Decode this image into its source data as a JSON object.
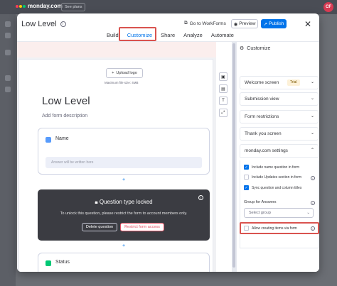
{
  "app": {
    "brand": "monday.com",
    "plans_button": "See plans",
    "avatar_initials": "CF"
  },
  "modal": {
    "title": "Low Level",
    "tabs": [
      {
        "label": "Build",
        "active": false
      },
      {
        "label": "Customize",
        "active": true
      },
      {
        "label": "Share",
        "active": false
      },
      {
        "label": "Analyze",
        "active": false
      },
      {
        "label": "Automate",
        "active": false
      }
    ],
    "goto_workforms": "Go to WorkForms",
    "preview_label": "Preview",
    "publish_label": "Publish",
    "accent_color": "#0073ea"
  },
  "form": {
    "upload_logo": "Upload logo",
    "max_file_size": "Maximum file size: 4MB",
    "title": "Low Level",
    "description_placeholder": "Add form description",
    "q1_name": "Name",
    "q1_answer_placeholder": "Answer will be written here",
    "locked_title": "Question type locked",
    "locked_message": "To unlock this question, please restrict the form to account members only.",
    "delete_question": "Delete question",
    "restrict_access": "Restrict form access",
    "q3_name": "Status",
    "plus_icon": "+"
  },
  "panel": {
    "title": "Customize",
    "sections": {
      "welcome": "Welcome screen",
      "trial_badge": "Trial",
      "submission": "Submission view",
      "restrictions": "Form restrictions",
      "thankyou": "Thank you screen",
      "settings": "monday.com settings"
    },
    "settings_items": [
      {
        "label": "Include name question in form",
        "checked": true
      },
      {
        "label": "Include Updates section in form",
        "checked": false
      },
      {
        "label": "Sync question and column titles",
        "checked": true
      }
    ],
    "group_label": "Group for Answers",
    "group_select": "Select group",
    "allow_items_label": "Allow creating items via form",
    "allow_items_checked": false
  }
}
